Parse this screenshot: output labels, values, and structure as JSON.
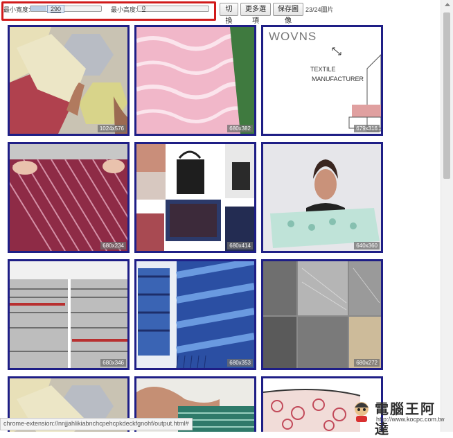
{
  "toolbar": {
    "min_width_label": "最小寬度:",
    "min_width_value": "290",
    "min_width_fraction": 0.23,
    "min_height_label": "最小高度:",
    "min_height_value": "0",
    "min_height_fraction": 0.0,
    "toggle_label": "切換",
    "more_options_label": "更多選項",
    "save_label": "保存圖像",
    "counter": "23/24圖片",
    "highlight_color": "#d11a1a"
  },
  "gallery": {
    "border_color": "#1e1e86",
    "tiles": [
      {
        "size": "1024x576",
        "subject": "yellow-geometric-textile"
      },
      {
        "size": "680x382",
        "subject": "pink-white-textile"
      },
      {
        "size": "679x316",
        "subject": "wovns-sketch",
        "sketch": {
          "brand": "WOVNS",
          "line1": "TEXTILE",
          "line2": "MANUFACTURER"
        }
      },
      {
        "size": "680x234",
        "subject": "maroon-striped-fabric"
      },
      {
        "size": "680x414",
        "subject": "bags-collage"
      },
      {
        "size": "640x360",
        "subject": "woman-holding-fabric"
      },
      {
        "size": "680x346",
        "subject": "grey-patchwork-textile"
      },
      {
        "size": "680x353",
        "subject": "blue-striped-fabric"
      },
      {
        "size": "680x272",
        "subject": "loom-collage"
      },
      {
        "size": "",
        "subject": "yellow-geometric-textile"
      },
      {
        "size": "",
        "subject": "weaving-hands"
      },
      {
        "size": "",
        "subject": "red-pattern-pouch"
      }
    ]
  },
  "statusbar": {
    "url": "chrome-extension://nnjjahlikiabnchcpehcpkdeckfgnohf/output.html#"
  },
  "watermark": {
    "title": "電腦王阿達",
    "url": "http://www.kocpc.com.tw"
  }
}
